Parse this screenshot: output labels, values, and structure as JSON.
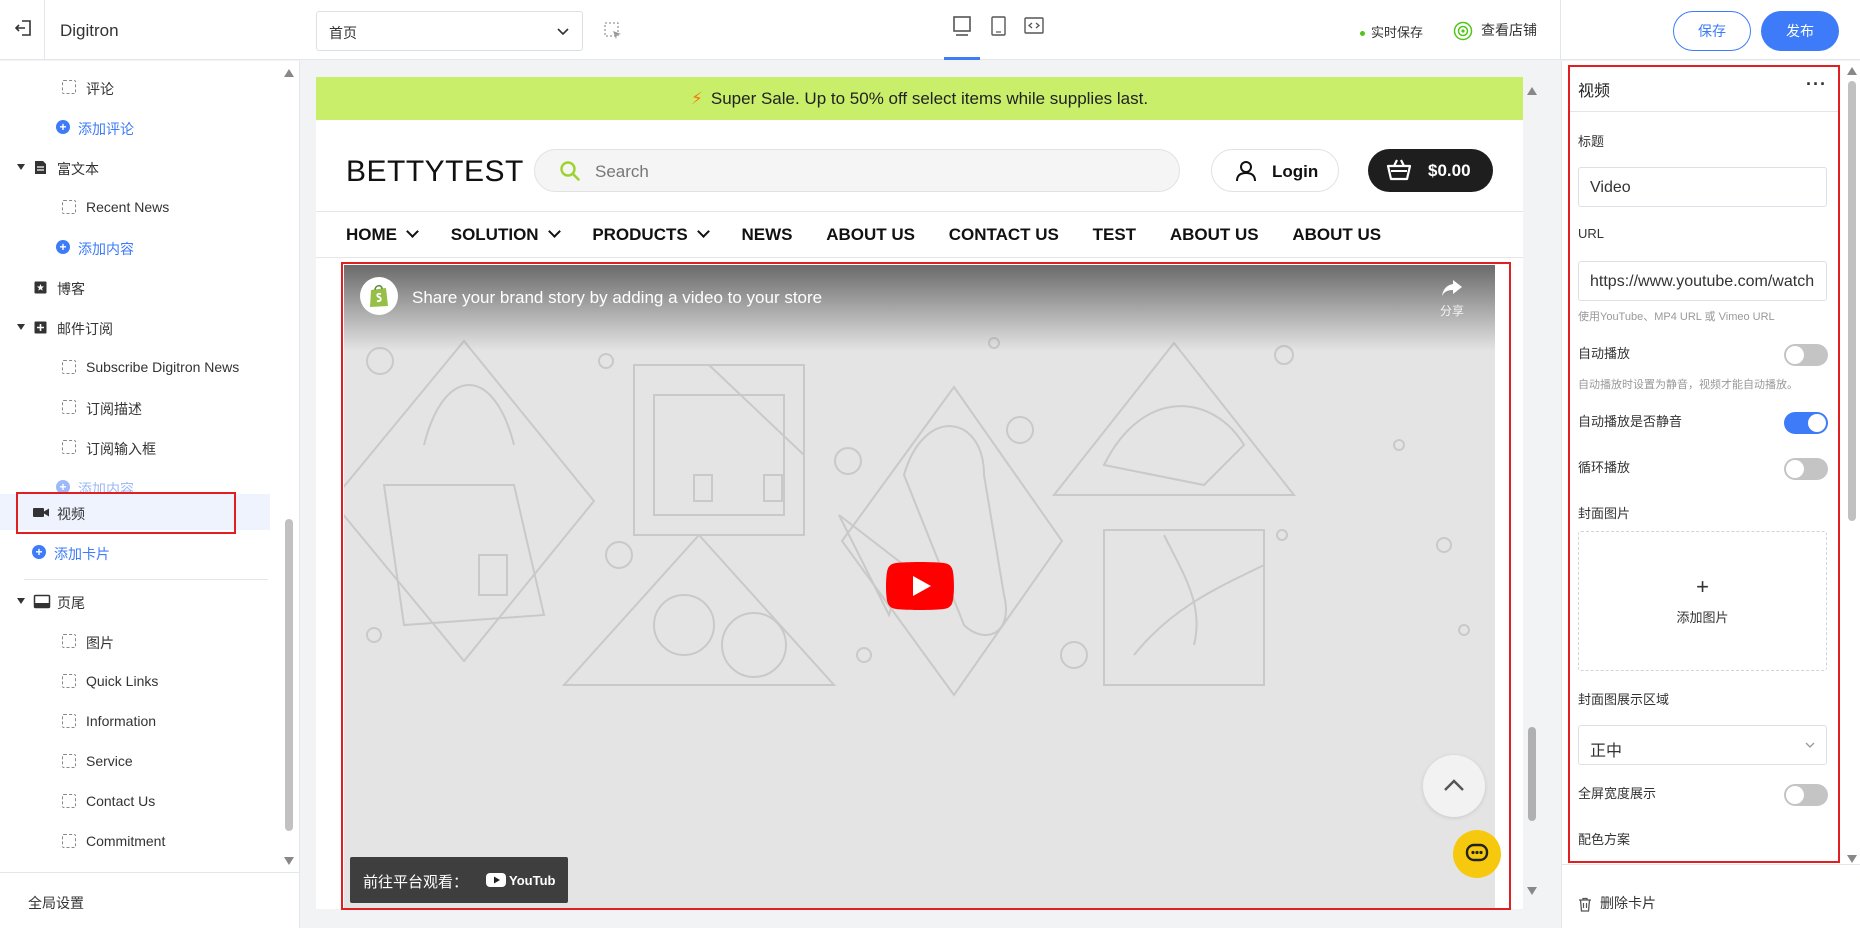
{
  "topbar": {
    "app_title": "Digitron",
    "page_select": "首页",
    "autosave": "实时保存",
    "view_store": "查看店铺",
    "save_label": "保存",
    "publish_label": "发布"
  },
  "sidebar": {
    "items": [
      {
        "label": "评论"
      },
      {
        "label": "添加评论"
      },
      {
        "label": "富文本"
      },
      {
        "label": "Recent News"
      },
      {
        "label": "添加内容"
      },
      {
        "label": "博客"
      },
      {
        "label": "邮件订阅"
      },
      {
        "label": "Subscribe Digitron News"
      },
      {
        "label": "订阅描述"
      },
      {
        "label": "订阅输入框"
      },
      {
        "label": "添加内容"
      },
      {
        "label": "视频"
      },
      {
        "label": "添加卡片"
      },
      {
        "label": "页尾"
      },
      {
        "label": "图片"
      },
      {
        "label": "Quick Links"
      },
      {
        "label": "Information"
      },
      {
        "label": "Service"
      },
      {
        "label": "Contact Us"
      },
      {
        "label": "Commitment"
      }
    ],
    "global_settings": "全局设置"
  },
  "store": {
    "announcement": "Super Sale. Up to 50% off select items while supplies last.",
    "brand": "BETTYTEST",
    "search_placeholder": "Search",
    "login": "Login",
    "cart_total": "$0.00",
    "nav": [
      "HOME",
      "SOLUTION",
      "PRODUCTS",
      "NEWS",
      "ABOUT US",
      "CONTACT US",
      "TEST",
      "ABOUT US",
      "ABOUT US"
    ],
    "video": {
      "title": "Share your brand story by adding a video to your store",
      "share": "分享",
      "watch_on": "前往平台观看：",
      "platform": "YouTube"
    }
  },
  "panel": {
    "title": "视频",
    "title_label": "标题",
    "title_value": "Video",
    "url_label": "URL",
    "url_value": "https://www.youtube.com/watch",
    "url_help": "使用YouTube、MP4 URL 或 Vimeo URL",
    "autoplay_label": "自动播放",
    "autoplay_on": false,
    "autoplay_help": "自动播放时设置为静音，视频才能自动播放。",
    "mute_label": "自动播放是否静音",
    "mute_on": true,
    "loop_label": "循环播放",
    "loop_on": false,
    "cover_label": "封面图片",
    "add_image": "添加图片",
    "cover_area_label": "封面图展示区域",
    "cover_area_value": "正中",
    "fullwidth_label": "全屏宽度展示",
    "fullwidth_on": false,
    "color_scheme_label": "配色方案",
    "delete_card": "删除卡片"
  },
  "colors": {
    "accent": "#3d7bf8",
    "announcement_bg": "#c9ef6a",
    "highlight_border": "#e02020"
  }
}
